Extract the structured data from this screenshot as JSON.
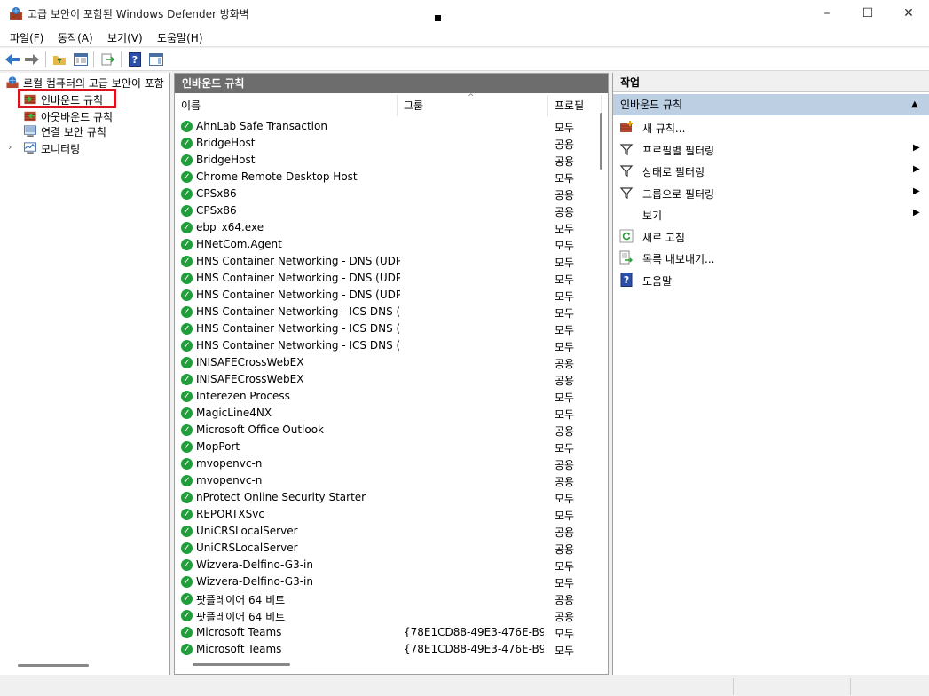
{
  "window": {
    "title": "고급 보안이 포함된 Windows Defender 방화벽",
    "icon": "firewall-app-icon",
    "controls": {
      "minimize": "–",
      "maximize": "☐",
      "close": "✕"
    }
  },
  "menu": {
    "file": "파일(F)",
    "action": "동작(A)",
    "view": "보기(V)",
    "help": "도움말(H)"
  },
  "tree": {
    "root": "로컬 컴퓨터의 고급 보안이 포함",
    "items": [
      {
        "label": "인바운드 규칙",
        "icon": "inbound-rules-icon",
        "selected": true
      },
      {
        "label": "아웃바운드 규칙",
        "icon": "outbound-rules-icon"
      },
      {
        "label": "연결 보안 규칙",
        "icon": "connection-security-icon"
      },
      {
        "label": "모니터링",
        "icon": "monitoring-icon"
      }
    ],
    "expander": "›"
  },
  "center": {
    "header": "인바운드 규칙",
    "columns": {
      "name": "이름",
      "group": "그룹",
      "profile": "프로필"
    },
    "sort_indicator": "^",
    "rules": [
      {
        "name": "AhnLab Safe Transaction",
        "group": "",
        "profile": "모두"
      },
      {
        "name": "BridgeHost",
        "group": "",
        "profile": "공용"
      },
      {
        "name": "BridgeHost",
        "group": "",
        "profile": "공용"
      },
      {
        "name": "Chrome Remote Desktop Host",
        "group": "",
        "profile": "모두"
      },
      {
        "name": "CPSx86",
        "group": "",
        "profile": "공용"
      },
      {
        "name": "CPSx86",
        "group": "",
        "profile": "공용"
      },
      {
        "name": "ebp_x64.exe",
        "group": "",
        "profile": "모두"
      },
      {
        "name": "HNetCom.Agent",
        "group": "",
        "profile": "모두"
      },
      {
        "name": "HNS Container Networking - DNS (UDP...",
        "group": "",
        "profile": "모두"
      },
      {
        "name": "HNS Container Networking - DNS (UDP...",
        "group": "",
        "profile": "모두"
      },
      {
        "name": "HNS Container Networking - DNS (UDP...",
        "group": "",
        "profile": "모두"
      },
      {
        "name": "HNS Container Networking - ICS DNS (...",
        "group": "",
        "profile": "모두"
      },
      {
        "name": "HNS Container Networking - ICS DNS (...",
        "group": "",
        "profile": "모두"
      },
      {
        "name": "HNS Container Networking - ICS DNS (...",
        "group": "",
        "profile": "모두"
      },
      {
        "name": "INISAFECrossWebEX",
        "group": "",
        "profile": "공용"
      },
      {
        "name": "INISAFECrossWebEX",
        "group": "",
        "profile": "공용"
      },
      {
        "name": "Interezen Process",
        "group": "",
        "profile": "모두"
      },
      {
        "name": "MagicLine4NX",
        "group": "",
        "profile": "모두"
      },
      {
        "name": "Microsoft Office Outlook",
        "group": "",
        "profile": "공용"
      },
      {
        "name": "MopPort",
        "group": "",
        "profile": "모두"
      },
      {
        "name": "mvopenvc-n",
        "group": "",
        "profile": "공용"
      },
      {
        "name": "mvopenvc-n",
        "group": "",
        "profile": "공용"
      },
      {
        "name": "nProtect Online Security Starter",
        "group": "",
        "profile": "모두"
      },
      {
        "name": "REPORTXSvc",
        "group": "",
        "profile": "모두"
      },
      {
        "name": "UniCRSLocalServer",
        "group": "",
        "profile": "공용"
      },
      {
        "name": "UniCRSLocalServer",
        "group": "",
        "profile": "공용"
      },
      {
        "name": "Wizvera-Delfino-G3-in",
        "group": "",
        "profile": "모두"
      },
      {
        "name": "Wizvera-Delfino-G3-in",
        "group": "",
        "profile": "모두"
      },
      {
        "name": "팟플레이어 64 비트",
        "group": "",
        "profile": "공용"
      },
      {
        "name": "팟플레이어 64 비트",
        "group": "",
        "profile": "공용"
      },
      {
        "name": "Microsoft Teams",
        "group": "{78E1CD88-49E3-476E-B9...",
        "profile": "모두"
      },
      {
        "name": "Microsoft Teams",
        "group": "{78E1CD88-49E3-476E-B9...",
        "profile": "모두"
      }
    ]
  },
  "actions": {
    "header": "작업",
    "section": "인바운드 규칙",
    "section_arrow": "▲",
    "items": [
      {
        "label": "새 규칙...",
        "icon": "new-rule-icon",
        "submenu": false
      },
      {
        "label": "프로필별 필터링",
        "icon": "filter-icon",
        "submenu": true
      },
      {
        "label": "상태로 필터링",
        "icon": "filter-icon",
        "submenu": true
      },
      {
        "label": "그룹으로 필터링",
        "icon": "filter-icon",
        "submenu": true
      },
      {
        "label": "보기",
        "icon": "",
        "submenu": true
      },
      {
        "label": "새로 고침",
        "icon": "refresh-icon",
        "submenu": false
      },
      {
        "label": "목록 내보내기...",
        "icon": "export-list-icon",
        "submenu": false
      },
      {
        "label": "도움말",
        "icon": "help-icon",
        "submenu": false
      }
    ],
    "submenu_arrow": "▶"
  },
  "colors": {
    "pane_header_bg": "#6d6d6d",
    "section_bg": "#bccfe3",
    "highlight_border": "#d9141c",
    "rule_enabled_green": "#1f9f3a"
  }
}
